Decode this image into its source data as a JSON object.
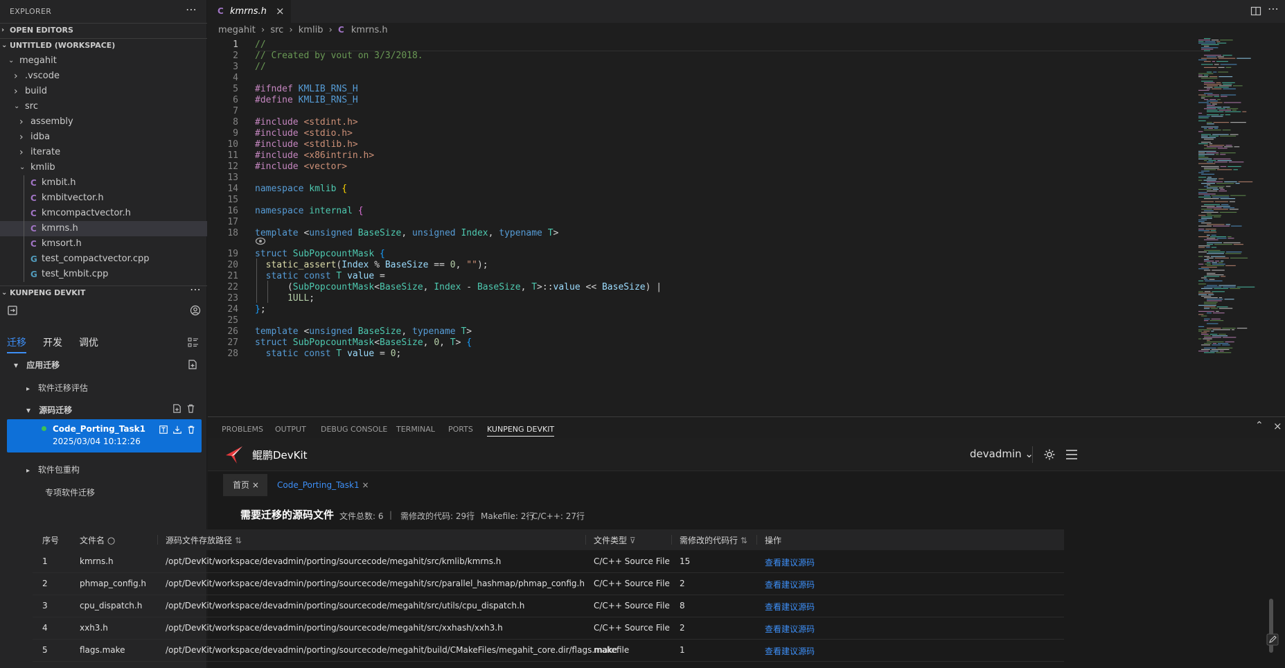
{
  "sidebar": {
    "title": "EXPLORER",
    "open_editors": "OPEN EDITORS",
    "workspace": "UNTITLED (WORKSPACE)",
    "tree": [
      {
        "label": "megahit",
        "kind": "folder-open",
        "depth": 0
      },
      {
        "label": ".vscode",
        "kind": "folder",
        "depth": 1
      },
      {
        "label": "build",
        "kind": "folder",
        "depth": 1
      },
      {
        "label": "src",
        "kind": "folder-open",
        "depth": 1
      },
      {
        "label": "assembly",
        "kind": "folder",
        "depth": 2
      },
      {
        "label": "idba",
        "kind": "folder",
        "depth": 2
      },
      {
        "label": "iterate",
        "kind": "folder",
        "depth": 2
      },
      {
        "label": "kmlib",
        "kind": "folder-open",
        "depth": 2
      },
      {
        "label": "kmbit.h",
        "kind": "c",
        "depth": 3
      },
      {
        "label": "kmbitvector.h",
        "kind": "c",
        "depth": 3
      },
      {
        "label": "kmcompactvector.h",
        "kind": "c",
        "depth": 3
      },
      {
        "label": "kmrns.h",
        "kind": "c",
        "depth": 3,
        "selected": true
      },
      {
        "label": "kmsort.h",
        "kind": "c",
        "depth": 3
      },
      {
        "label": "test_compactvector.cpp",
        "kind": "cpp",
        "depth": 3
      },
      {
        "label": "test_kmbit.cpp",
        "kind": "cpp",
        "depth": 3
      }
    ],
    "kunpeng_header": "KUNPENG DEVKIT",
    "kp_tabs": [
      "迁移",
      "开发",
      "调优"
    ],
    "app_migration": "应用迁移",
    "software_assessment": "软件迁移评估",
    "source_migration": "源码迁移",
    "task_name": "Code_Porting_Task1",
    "task_time": "2025/03/04 10:12:26",
    "package_rebuild": "软件包重构",
    "special_migration": "专项软件迁移"
  },
  "editor": {
    "tab_label": "kmrns.h",
    "breadcrumb": [
      "megahit",
      "src",
      "kmlib",
      "kmrns.h"
    ],
    "line_numbers": [
      "1",
      "2",
      "3",
      "4",
      "5",
      "6",
      "7",
      "8",
      "9",
      "10",
      "11",
      "12",
      "13",
      "14",
      "15",
      "16",
      "17",
      "18",
      "19",
      "20",
      "21",
      "22",
      "23",
      "24",
      "25",
      "26",
      "27",
      "28"
    ]
  },
  "panel": {
    "tabs": [
      "PROBLEMS",
      "OUTPUT",
      "DEBUG CONSOLE",
      "TERMINAL",
      "PORTS",
      "KUNPENG DEVKIT"
    ],
    "active_tab": "KUNPENG DEVKIT"
  },
  "devkit": {
    "brand": "鲲鹏DevKit",
    "user": "devadmin",
    "tabs": [
      "首页",
      "Code_Porting_Task1"
    ],
    "section_title": "需要迁移的源码文件",
    "stat_total": "文件总数:   6",
    "stat_lines": "需修改的代码: 29行",
    "stat_makefile": "Makefile: 2行",
    "stat_cpp": "C/C++: 27行",
    "columns": [
      "序号",
      "文件名",
      "源码文件存放路径",
      "文件类型",
      "需修改的代码行",
      "操作"
    ],
    "rows": [
      {
        "no": "1",
        "name": "kmrns.h",
        "path": "/opt/DevKit/workspace/devadmin/porting/sourcecode/megahit/src/kmlib/kmrns.h",
        "type": "C/C++ Source File",
        "lines": "15",
        "action": "查看建议源码"
      },
      {
        "no": "2",
        "name": "phmap_config.h",
        "path": "/opt/DevKit/workspace/devadmin/porting/sourcecode/megahit/src/parallel_hashmap/phmap_config.h",
        "type": "C/C++ Source File",
        "lines": "2",
        "action": "查看建议源码"
      },
      {
        "no": "3",
        "name": "cpu_dispatch.h",
        "path": "/opt/DevKit/workspace/devadmin/porting/sourcecode/megahit/src/utils/cpu_dispatch.h",
        "type": "C/C++ Source File",
        "lines": "8",
        "action": "查看建议源码"
      },
      {
        "no": "4",
        "name": "xxh3.h",
        "path": "/opt/DevKit/workspace/devadmin/porting/sourcecode/megahit/src/xxhash/xxh3.h",
        "type": "C/C++ Source File",
        "lines": "2",
        "action": "查看建议源码"
      },
      {
        "no": "5",
        "name": "flags.make",
        "path": "/opt/DevKit/workspace/devadmin/porting/sourcecode/megahit/build/CMakeFiles/megahit_core.dir/flags.make",
        "type": "makefile",
        "lines": "1",
        "action": "查看建议源码"
      }
    ]
  },
  "colors": {
    "accent": "#0e70d8",
    "link": "#3d8ff7"
  }
}
